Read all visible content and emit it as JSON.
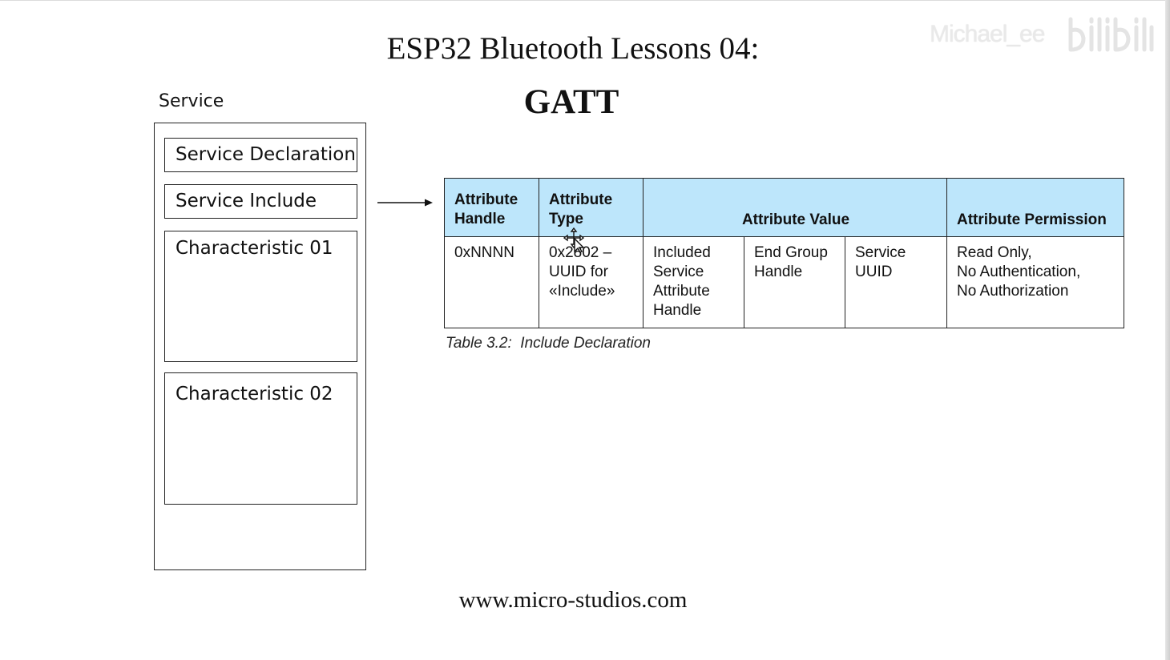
{
  "slide": {
    "title": "ESP32 Bluetooth Lessons 04:",
    "subtitle": "GATT",
    "footer": "www.micro-studios.com",
    "watermark": "Michael_ee"
  },
  "service_diagram": {
    "label": "Service",
    "boxes": [
      "Service Declaration",
      "Service Include",
      "Characteristic 01",
      "Characteristic 02"
    ]
  },
  "table": {
    "headers": {
      "handle": "Attribute Handle",
      "type": "Attribute Type",
      "value": "Attribute Value",
      "permission": "Attribute Permission"
    },
    "row": {
      "handle": "0xNNNN",
      "type": "0x2802 – UUID for «Include»",
      "value_1": "Included Service Attribute Handle",
      "value_2": "End Group Handle",
      "value_3": "Service UUID",
      "permission": "Read Only,\nNo Authentication,\nNo Authorization"
    },
    "caption": "Table 3.2:  Include Declaration",
    "header_color": "#bde6fb"
  }
}
